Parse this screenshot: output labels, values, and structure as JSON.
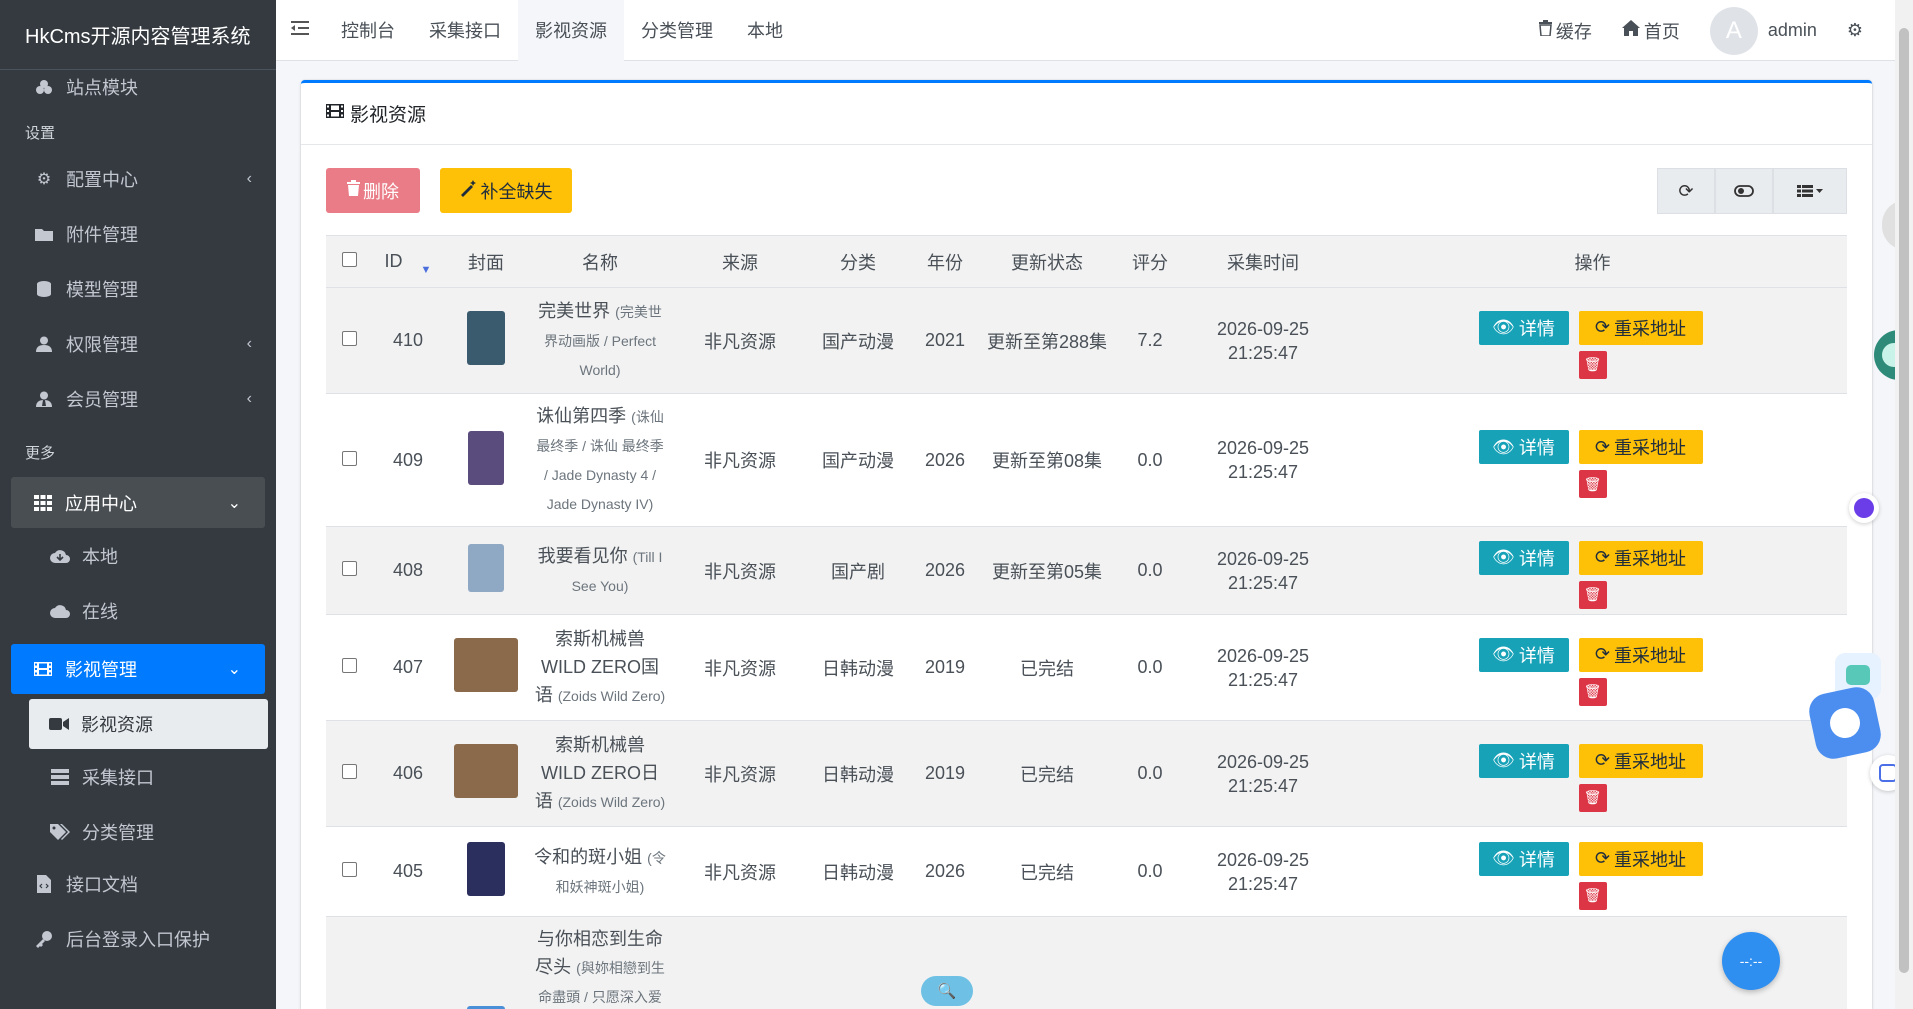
{
  "sidebar": {
    "brand": "HkCms开源内容管理系统",
    "items": [
      {
        "label": "站点模块"
      },
      {
        "header": "设置"
      },
      {
        "label": "配置中心"
      },
      {
        "label": "附件管理"
      },
      {
        "label": "模型管理"
      },
      {
        "label": "权限管理"
      },
      {
        "label": "会员管理"
      },
      {
        "header": "更多"
      },
      {
        "label": "应用中心"
      },
      {
        "label": "本地"
      },
      {
        "label": "在线"
      },
      {
        "label": "影视管理"
      },
      {
        "label": "影视资源"
      },
      {
        "label": "采集接口"
      },
      {
        "label": "分类管理"
      },
      {
        "label": "接口文档"
      },
      {
        "label": "后台登录入口保护"
      }
    ]
  },
  "topbar": {
    "tabs": [
      "控制台",
      "采集接口",
      "影视资源",
      "分类管理",
      "本地"
    ],
    "cache": "缓存",
    "home": "首页",
    "avatar_letter": "A",
    "user": "admin"
  },
  "card": {
    "title": "影视资源",
    "delete_label": "删除",
    "fill_label": "补全缺失"
  },
  "table": {
    "headers": [
      "ID",
      "封面",
      "名称",
      "来源",
      "分类",
      "年份",
      "更新状态",
      "评分",
      "采集时间",
      "操作"
    ],
    "detail_label": "详情",
    "recap_label": "重采地址",
    "rows": [
      {
        "id": "410",
        "name": "完美世界",
        "alias": "(完美世界动画版 / Perfect World)",
        "source": "非凡资源",
        "category": "国产动漫",
        "year": "2021",
        "status": "更新至第288集",
        "score": "7.2",
        "date": "2026-09-25",
        "time": "21:25:47",
        "cover_color": "#3a5a6e"
      },
      {
        "id": "409",
        "name": "诛仙第四季",
        "alias": "(诛仙最终季 / 诛仙 最终季 / Jade Dynasty 4 / Jade Dynasty IV)",
        "source": "非凡资源",
        "category": "国产动漫",
        "year": "2026",
        "status": "更新至第08集",
        "score": "0.0",
        "date": "2026-09-25",
        "time": "21:25:47",
        "cover_color": "#5a4c7c"
      },
      {
        "id": "408",
        "name": "我要看见你",
        "alias": "(Till I See You)",
        "source": "非凡资源",
        "category": "国产剧",
        "year": "2026",
        "status": "更新至第05集",
        "score": "0.0",
        "date": "2026-09-25",
        "time": "21:25:47",
        "cover_color": "#8fa9c4"
      },
      {
        "id": "407",
        "name": "索斯机械兽WILD ZERO国语",
        "alias": "(Zoids Wild Zero)",
        "source": "非凡资源",
        "category": "日韩动漫",
        "year": "2019",
        "status": "已完结",
        "score": "0.0",
        "date": "2026-09-25",
        "time": "21:25:47",
        "cover_color": "#8a6a4a"
      },
      {
        "id": "406",
        "name": "索斯机械兽WILD ZERO日语",
        "alias": "(Zoids Wild Zero)",
        "source": "非凡资源",
        "category": "日韩动漫",
        "year": "2019",
        "status": "已完结",
        "score": "0.0",
        "date": "2026-09-25",
        "time": "21:25:47",
        "cover_color": "#8a6a4a"
      },
      {
        "id": "405",
        "name": "令和的斑小姐",
        "alias": "(令和妖神斑小姐)",
        "source": "非凡资源",
        "category": "日韩动漫",
        "year": "2026",
        "status": "已完结",
        "score": "0.0",
        "date": "2026-09-25",
        "time": "21:25:47",
        "cover_color": "#2b2f5e"
      },
      {
        "id": "",
        "name": "与你相恋到生命尽头",
        "alias": "(與妳相戀到生命盡頭 / 只愿深入爱河直至",
        "source": "",
        "category": "",
        "year": "",
        "status": "",
        "score": "",
        "date": "",
        "time": "",
        "cover_color": "#4a90d9"
      }
    ]
  },
  "colors": {
    "primary": "#007bff",
    "danger": "#dc3545",
    "warning": "#ffc107",
    "info": "#17a2b8",
    "sidebar": "#343a40"
  }
}
